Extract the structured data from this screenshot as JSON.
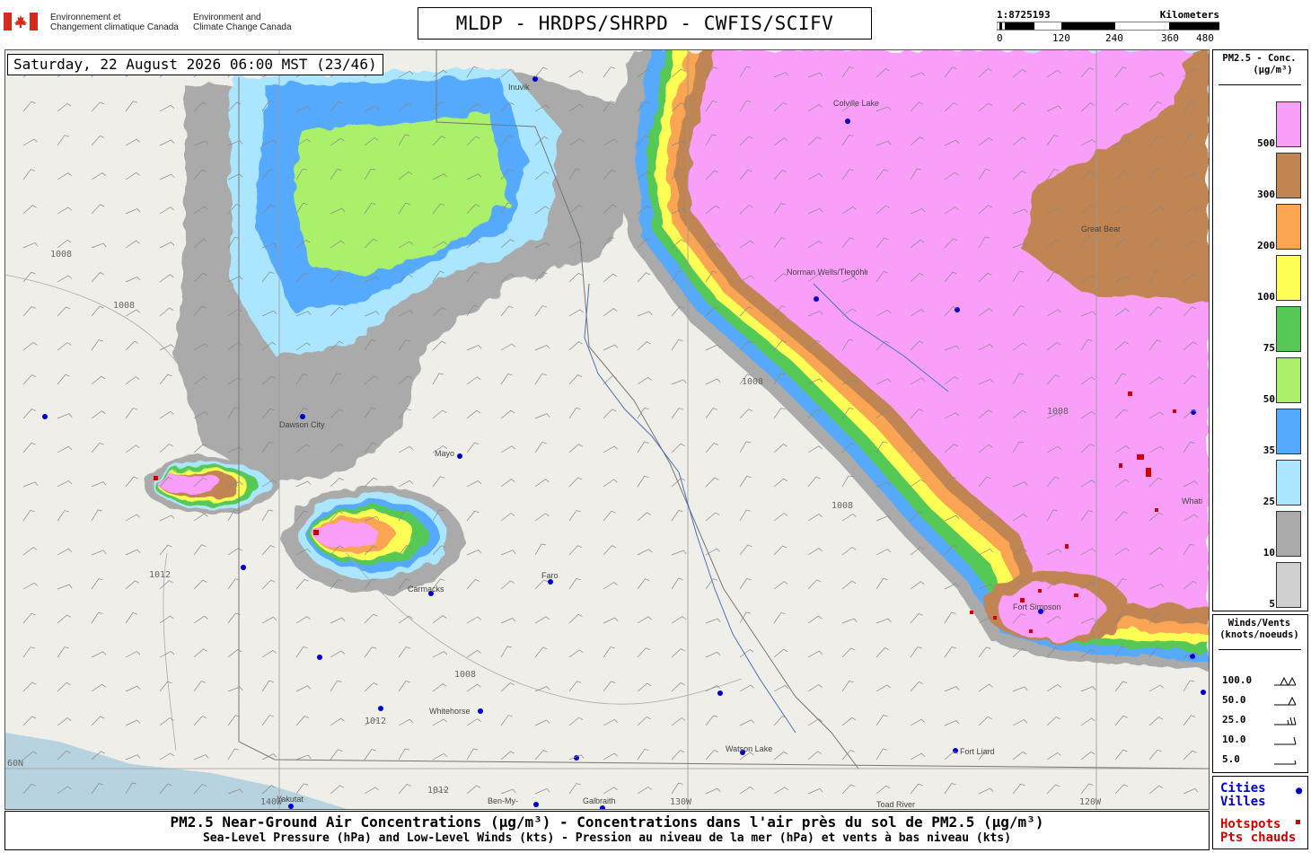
{
  "header": {
    "agency_fr": [
      "Environnement et",
      "Changement climatique Canada"
    ],
    "agency_en": [
      "Environment and",
      "Climate Change Canada"
    ],
    "title": "MLDP - HRDPS/SHRPD - CWFIS/SCIFV"
  },
  "scale": {
    "ratio": "1:8725193",
    "unit": "Kilometers",
    "ticks": [
      "0",
      "120",
      "240",
      "360",
      "480"
    ]
  },
  "map": {
    "timestamp": "Saturday, 22 August 2026 06:00 MST (23/46)",
    "places": [
      {
        "name": "Inuvik",
        "label": "Inuvik"
      },
      {
        "name": "Colville Lake",
        "label": "Colville Lake"
      },
      {
        "name": "Norman Wells",
        "label": "Norman Wells/Tłegóhłı"
      },
      {
        "name": "Dawson City",
        "label": "Dawson City"
      },
      {
        "name": "Mayo",
        "label": "Mayo"
      },
      {
        "name": "Carmacks",
        "label": "Carmacks"
      },
      {
        "name": "Faro",
        "label": "Faro"
      },
      {
        "name": "Whitehorse",
        "label": "Whitehorse"
      },
      {
        "name": "Watson Lake",
        "label": "Watson Lake"
      },
      {
        "name": "Fort Liard",
        "label": "Fort Liard"
      },
      {
        "name": "Fort Simpson",
        "label": "Fort Simpson"
      },
      {
        "name": "Great Bear",
        "label": "Great Bear"
      },
      {
        "name": "Yakutat",
        "label": "Yakutat"
      },
      {
        "name": "Ben-My-Chree",
        "label": "Ben-My-"
      },
      {
        "name": "Galbraith",
        "label": "Galbraith"
      },
      {
        "name": "Toad River",
        "label": "Toad River"
      },
      {
        "name": "Wha",
        "label": "Whati"
      }
    ],
    "isobar_labels": [
      "1008",
      "1012"
    ],
    "graticule_labels": [
      "60N",
      "140W",
      "130W",
      "120W"
    ]
  },
  "legend_pm": {
    "title": [
      "PM2.5 - Conc.",
      "(µg/m³)"
    ],
    "classes": [
      {
        "label": "500",
        "color": "#f99ff9"
      },
      {
        "label": "300",
        "color": "#c08552"
      },
      {
        "label": "200",
        "color": "#f9a552"
      },
      {
        "label": "100",
        "color": "#ffff55"
      },
      {
        "label": "75",
        "color": "#55c855"
      },
      {
        "label": "50",
        "color": "#aaf06a"
      },
      {
        "label": "35",
        "color": "#55aaff"
      },
      {
        "label": "25",
        "color": "#aae6ff"
      },
      {
        "label": "10",
        "color": "#aaaaaa"
      },
      {
        "label": "5",
        "color": "#d0d0d0"
      }
    ]
  },
  "legend_wind": {
    "title": [
      "Winds/Vents",
      "(knots/noeuds)"
    ],
    "rows": [
      "100.0",
      "50.0",
      "25.0",
      "10.0",
      "5.0"
    ]
  },
  "legend_features": {
    "cities": [
      "Cities",
      "Villes"
    ],
    "hotspots": [
      "Hotspots",
      "Pts chauds"
    ],
    "city_color": "#0000cc",
    "hotspot_color": "#cc0000"
  },
  "caption": {
    "line1": "PM2.5 Near-Ground Air Concentrations (µg/m³) - Concentrations dans l'air près du sol de PM2.5 (µg/m³)",
    "line2": "Sea-Level Pressure (hPa) and Low-Level Winds (kts) - Pression au niveau de la mer (hPa) et vents à bas niveau (kts)"
  }
}
